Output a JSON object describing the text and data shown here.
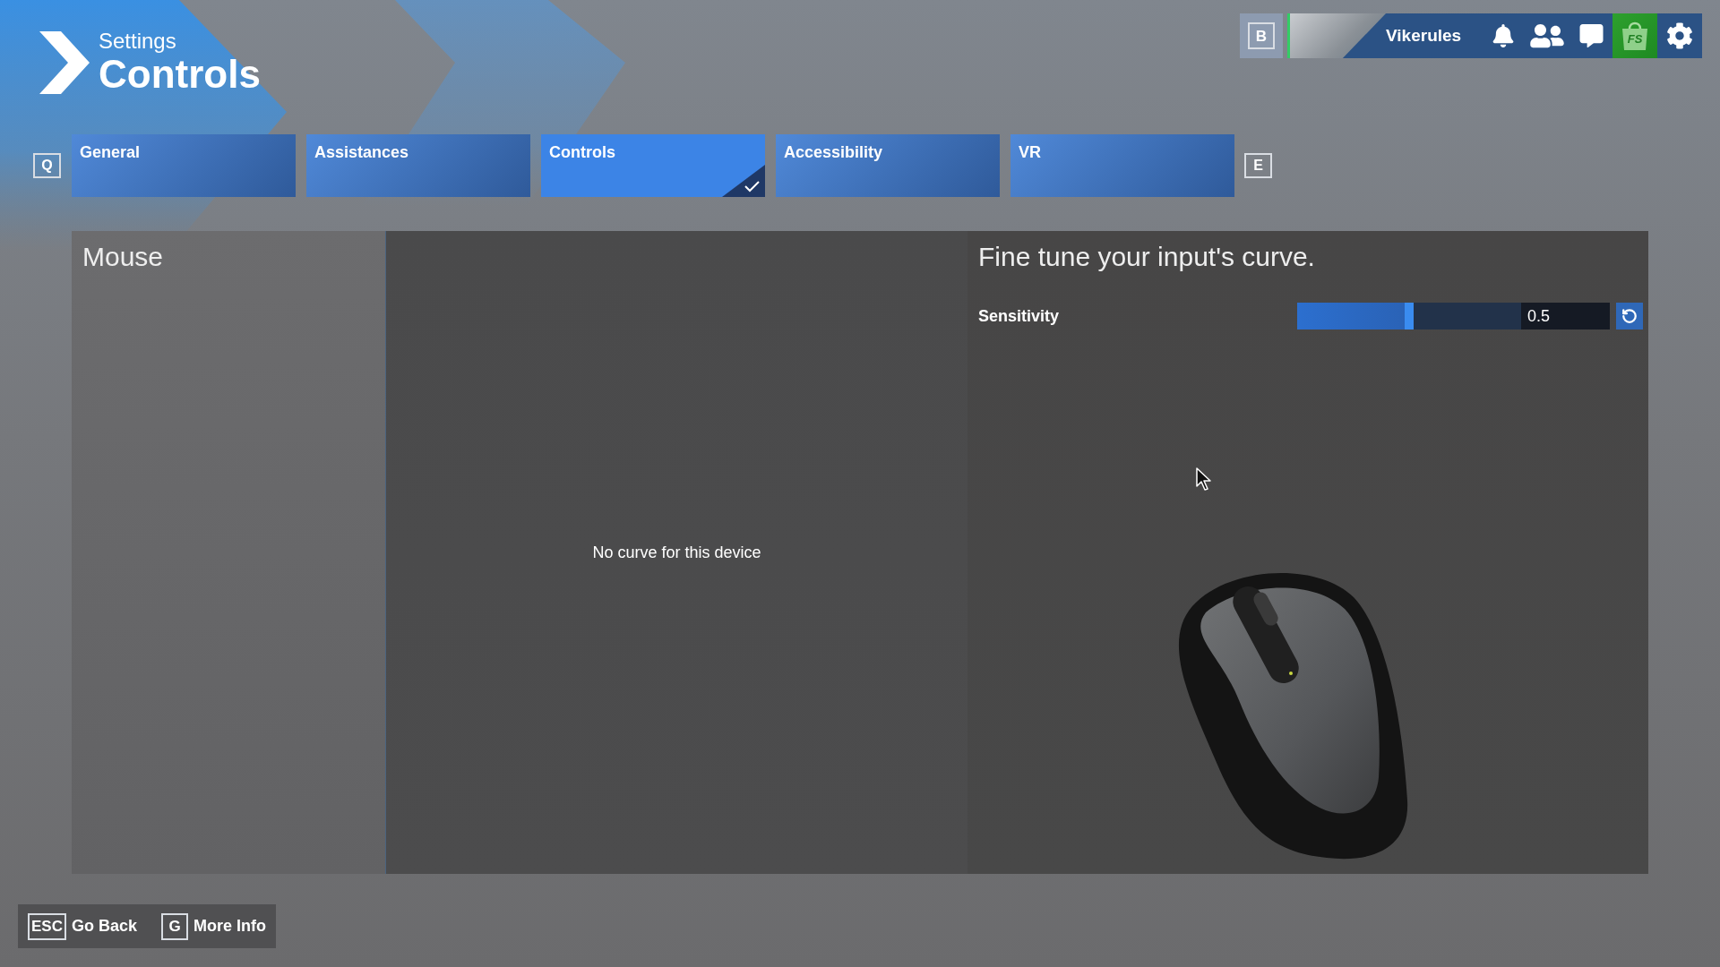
{
  "header": {
    "section": "Settings",
    "title": "Controls"
  },
  "user_bar": {
    "key": "B",
    "online": true,
    "username": "Vikerules",
    "store_label": "FS"
  },
  "tabs": {
    "prev_key": "Q",
    "next_key": "E",
    "items": [
      {
        "label": "General",
        "selected": false
      },
      {
        "label": "Assistances",
        "selected": false
      },
      {
        "label": "Controls",
        "selected": true
      },
      {
        "label": "Accessibility",
        "selected": false
      },
      {
        "label": "VR",
        "selected": false
      }
    ]
  },
  "device_panel": {
    "title": "Mouse"
  },
  "curve_panel": {
    "message": "No curve for this device"
  },
  "tuning_panel": {
    "title": "Fine tune your input's curve.",
    "settings": [
      {
        "label": "Sensitivity",
        "level": 0.5,
        "value": "0.5"
      }
    ]
  },
  "footer": {
    "actions": [
      {
        "key": "ESC",
        "label": "Go Back"
      },
      {
        "key": "G",
        "label": "More Info"
      }
    ]
  }
}
